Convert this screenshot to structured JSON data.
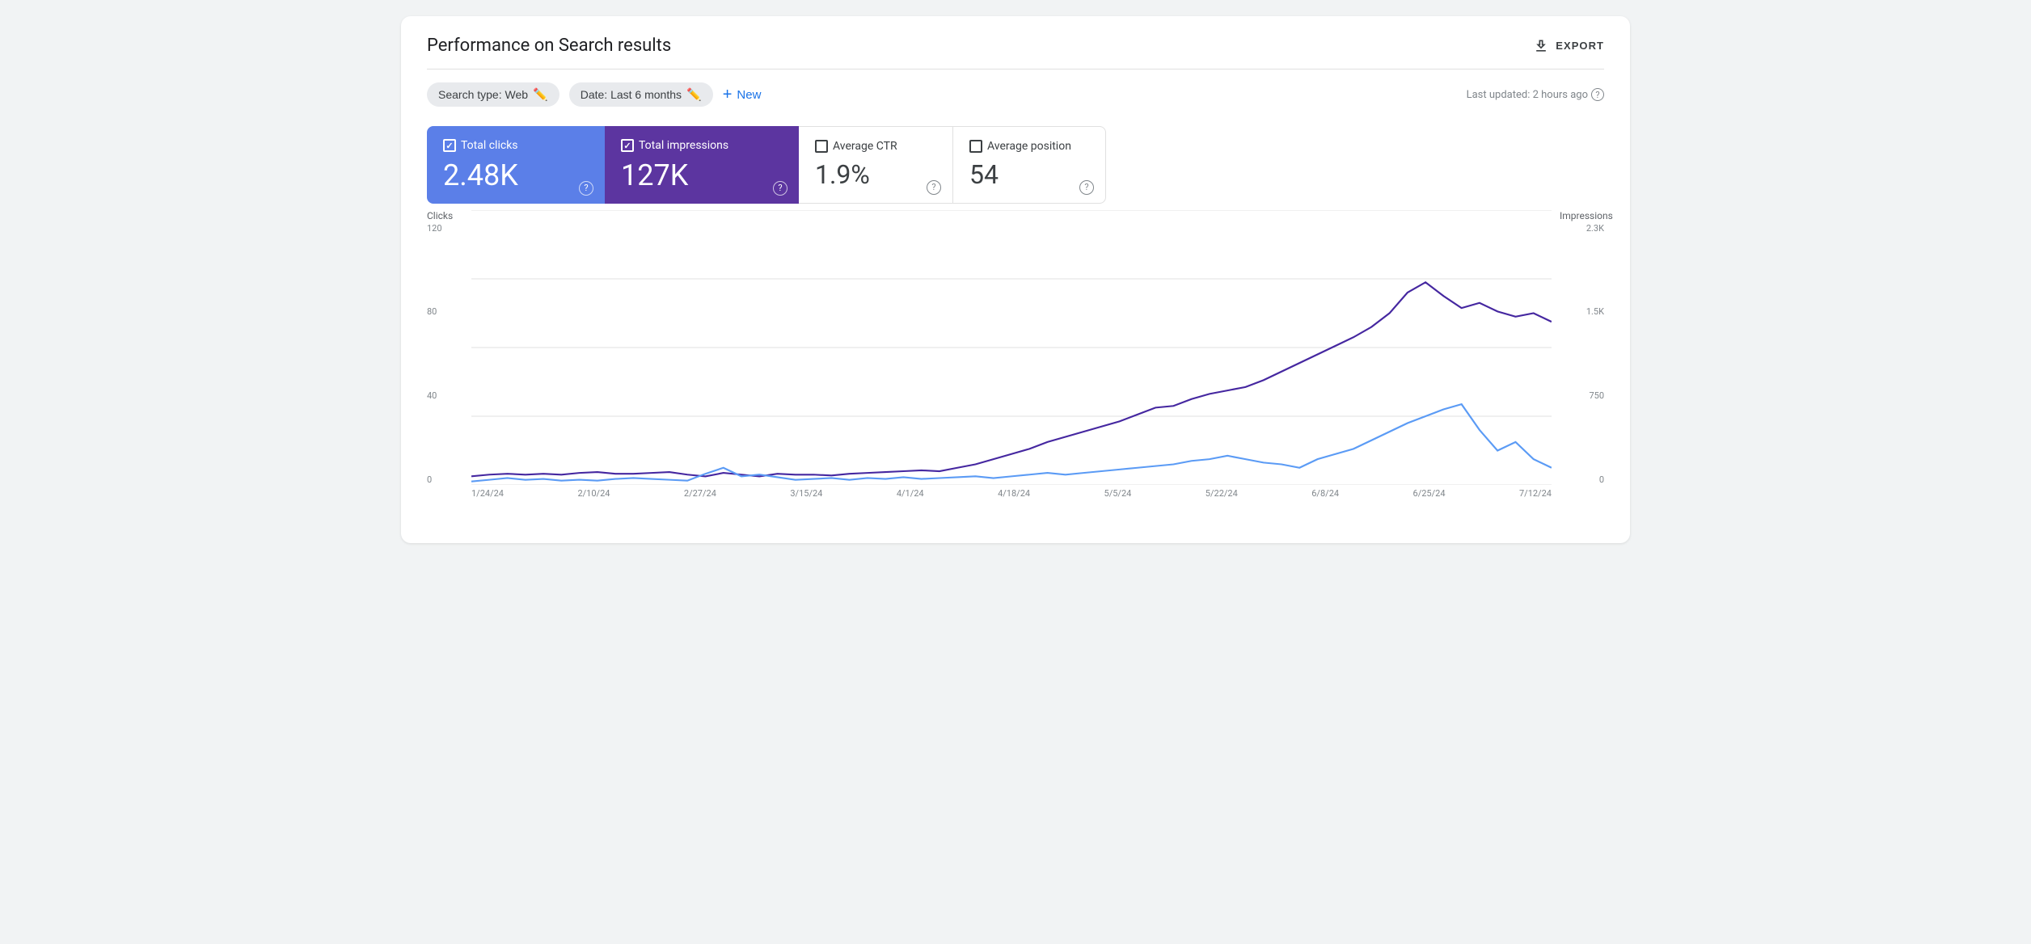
{
  "header": {
    "title": "Performance on Search results",
    "export_label": "EXPORT"
  },
  "filters": {
    "search_type_label": "Search type: Web",
    "date_label": "Date: Last 6 months",
    "new_label": "New",
    "last_updated": "Last updated: 2 hours ago"
  },
  "metrics": [
    {
      "id": "total-clicks",
      "label": "Total clicks",
      "value": "2.48K",
      "checked": true,
      "style": "active-blue"
    },
    {
      "id": "total-impressions",
      "label": "Total impressions",
      "value": "127K",
      "checked": true,
      "style": "active-purple"
    },
    {
      "id": "average-ctr",
      "label": "Average CTR",
      "value": "1.9%",
      "checked": false,
      "style": "inactive"
    },
    {
      "id": "average-position",
      "label": "Average position",
      "value": "54",
      "checked": false,
      "style": "inactive"
    }
  ],
  "chart": {
    "left_axis_title": "Clicks",
    "right_axis_title": "Impressions",
    "left_labels": [
      "120",
      "80",
      "40",
      "0"
    ],
    "right_labels": [
      "2.3K",
      "1.5K",
      "750",
      "0"
    ],
    "x_labels": [
      "1/24/24",
      "2/10/24",
      "2/27/24",
      "3/15/24",
      "4/1/24",
      "4/18/24",
      "5/5/24",
      "5/22/24",
      "6/8/24",
      "6/25/24",
      "7/12/24"
    ],
    "colors": {
      "clicks": "#5b9bf5",
      "impressions": "#4527a0",
      "grid": "#e0e0e0"
    }
  }
}
